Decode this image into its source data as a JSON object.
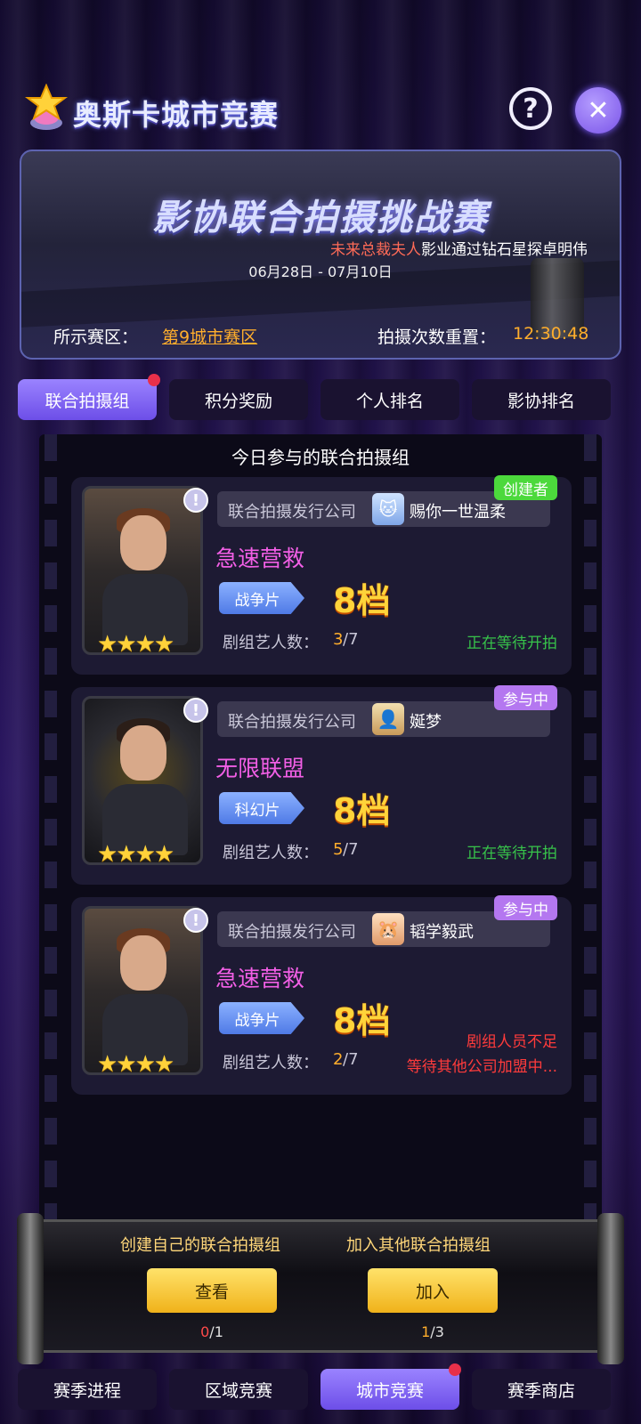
{
  "header": {
    "title": "奥斯卡城市竞赛",
    "help_icon": "question-circle-icon",
    "close_icon": "close-icon"
  },
  "banner": {
    "title": "影协联合拍摄挑战赛",
    "sub_highlight": "未来总裁夫人",
    "sub_rest": "影业通过钻石星探卓明伟",
    "date": "06月28日 - 07月10日",
    "zone_label": "所示赛区：",
    "zone_value": "第9城市赛区",
    "reset_label": "拍摄次数重置：",
    "reset_value": "12:30:48"
  },
  "tabs": [
    {
      "label": "联合拍摄组",
      "active": true,
      "dot": true
    },
    {
      "label": "积分奖励",
      "active": false
    },
    {
      "label": "个人排名",
      "active": false
    },
    {
      "label": "影协排名",
      "active": false
    }
  ],
  "panel": {
    "title": "今日参与的联合拍摄组"
  },
  "cards": [
    {
      "company_label": "联合拍摄发行公司",
      "company_name": "赐你一世温柔",
      "badge": "创建者",
      "movie_title": "急速营救",
      "genre": "战争片",
      "tier": "8档",
      "crew_label": "剧组艺人数：",
      "crew_current": "3",
      "crew_total": "/7",
      "status": "正在等待开拍",
      "stars": "★★★★"
    },
    {
      "company_label": "联合拍摄发行公司",
      "company_name": "娫梦",
      "badge": "参与中",
      "movie_title": "无限联盟",
      "genre": "科幻片",
      "tier": "8档",
      "crew_label": "剧组艺人数：",
      "crew_current": "5",
      "crew_total": "/7",
      "status": "正在等待开拍",
      "stars": "★★★★"
    },
    {
      "company_label": "联合拍摄发行公司",
      "company_name": "韬学毅武",
      "badge": "参与中",
      "movie_title": "急速营救",
      "genre": "战争片",
      "tier": "8档",
      "crew_label": "剧组艺人数：",
      "crew_current": "2",
      "crew_total": "/7",
      "status_line1": "剧组人员不足",
      "status_line2": "等待其他公司加盟中...",
      "stars": "★★★★"
    }
  ],
  "actions": {
    "create_label": "创建自己的联合拍摄组",
    "create_button": "查看",
    "create_count_current": "0",
    "create_count_total": "/1",
    "join_label": "加入其他联合拍摄组",
    "join_button": "加入",
    "join_count_current": "1",
    "join_count_total": "/3"
  },
  "bottom_nav": [
    {
      "label": "赛季进程",
      "active": false
    },
    {
      "label": "区域竞赛",
      "active": false
    },
    {
      "label": "城市竞赛",
      "active": true,
      "dot": true
    },
    {
      "label": "赛季商店",
      "active": false
    }
  ],
  "colors": {
    "accent": "#7a54e8",
    "highlight": "#ffae2c",
    "title_pink": "#f25fe6",
    "ok_green": "#37c24a",
    "warn_red": "#ff3b3b"
  }
}
